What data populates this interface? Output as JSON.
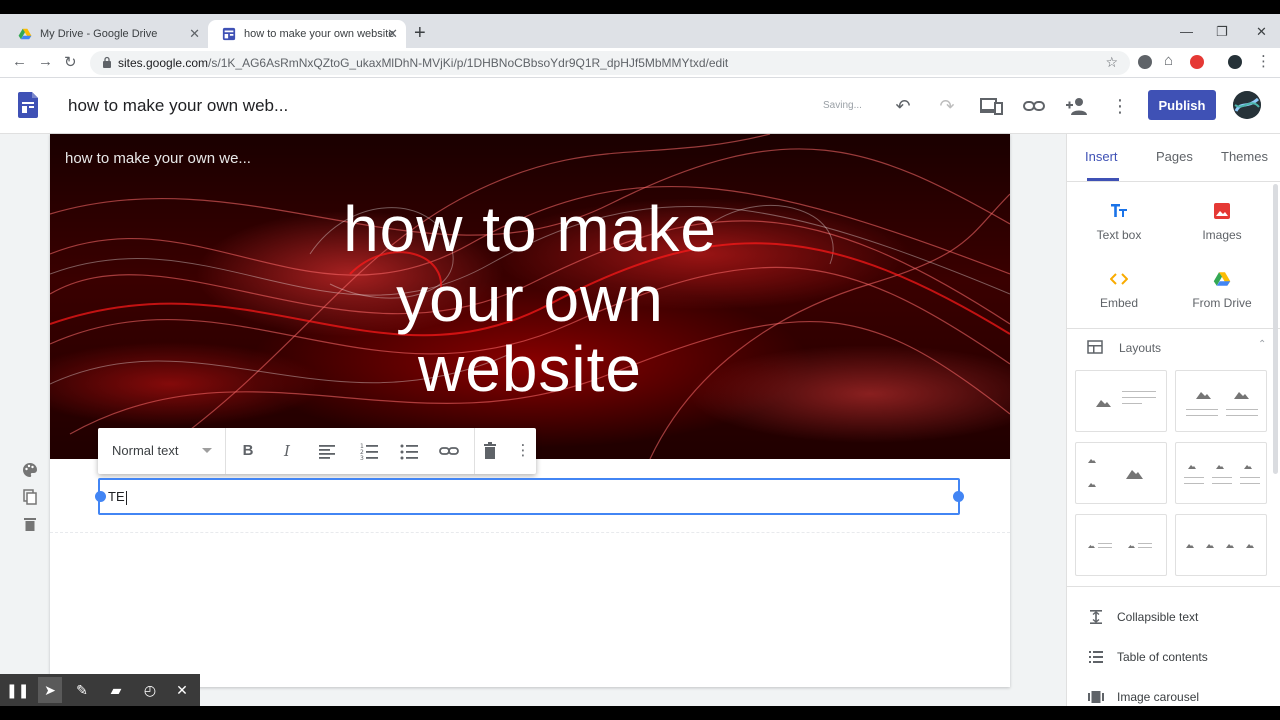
{
  "browser": {
    "tabs": [
      {
        "title": "My Drive - Google Drive"
      },
      {
        "title": "how to make your own website"
      }
    ],
    "new_tab": "+",
    "url_host": "sites.google.com",
    "url_path": "/s/1K_AG6AsRmNxQZtoG_ukaxMlDhN-MVjKi/p/1DHBNoCBbsoYdr9Q1R_dpHJf5MbMMYtxd/edit"
  },
  "app": {
    "doc_title": "how to make your own web...",
    "status": "Saving...",
    "publish_label": "Publish"
  },
  "page": {
    "site_name": "how to make your own we...",
    "hero_title": "how to make your own website"
  },
  "toolbar": {
    "style_label": "Normal text"
  },
  "textbox": {
    "content": "TE"
  },
  "panel": {
    "tabs": [
      {
        "label": "Insert",
        "active": true
      },
      {
        "label": "Pages",
        "active": false
      },
      {
        "label": "Themes",
        "active": false
      }
    ],
    "insert_items": [
      {
        "label": "Text box",
        "icon": "text-box-icon"
      },
      {
        "label": "Images",
        "icon": "image-icon"
      },
      {
        "label": "Embed",
        "icon": "embed-icon"
      },
      {
        "label": "From Drive",
        "icon": "drive-icon"
      }
    ],
    "layouts_label": "Layouts",
    "list_items": [
      {
        "label": "Collapsible text"
      },
      {
        "label": "Table of contents"
      },
      {
        "label": "Image carousel"
      }
    ]
  },
  "colors": {
    "accent": "#3f51b5",
    "selection": "#4285f4"
  }
}
